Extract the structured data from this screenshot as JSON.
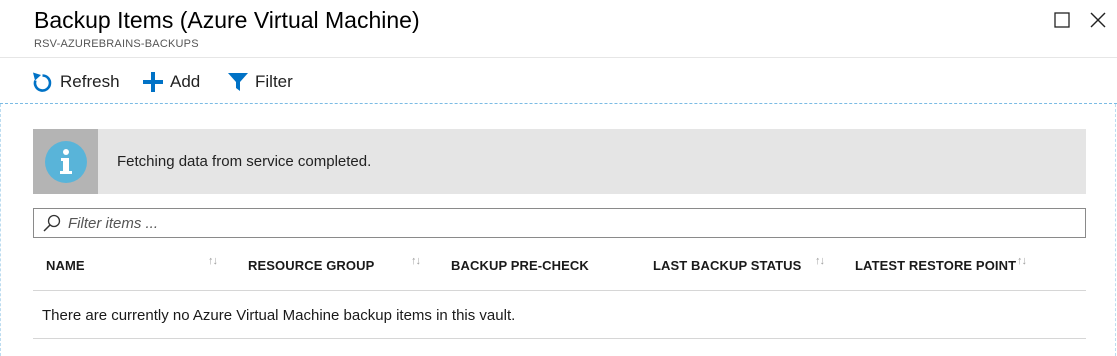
{
  "blade": {
    "title": "Backup Items (Azure Virtual Machine)",
    "subtitle": "RSV-AZUREBRAINS-BACKUPS"
  },
  "toolbar": {
    "refresh_label": "Refresh",
    "add_label": "Add",
    "filter_label": "Filter"
  },
  "info": {
    "message": "Fetching data from service completed."
  },
  "filter": {
    "placeholder": "Filter items ...",
    "value": ""
  },
  "grid": {
    "columns": [
      {
        "label": "NAME",
        "sortable": true
      },
      {
        "label": "RESOURCE GROUP",
        "sortable": true
      },
      {
        "label": "BACKUP PRE-CHECK",
        "sortable": false
      },
      {
        "label": "LAST BACKUP STATUS",
        "sortable": true
      },
      {
        "label": "LATEST RESTORE POINT",
        "sortable": true
      }
    ],
    "sort_glyph": "↑↓",
    "empty_message": "There are currently no Azure Virtual Machine backup items in this vault."
  },
  "icons": {
    "refresh": "refresh-icon",
    "add": "plus-icon",
    "filter": "funnel-icon",
    "info": "info-icon",
    "search": "search-icon",
    "maximize": "maximize-icon",
    "close": "close-icon"
  },
  "colors": {
    "accent": "#0072c6",
    "info_icon": "#59b4d9",
    "info_bar": "#e5e5e5"
  }
}
